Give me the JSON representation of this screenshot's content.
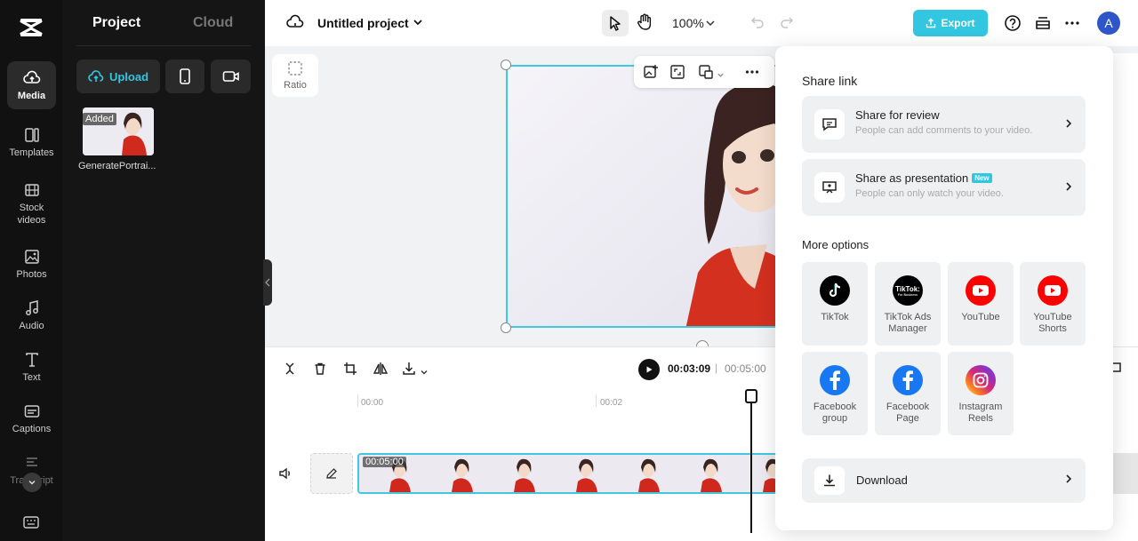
{
  "sidebar": {
    "items": [
      {
        "label": "Media",
        "icon": "cloud-media-icon",
        "active": true
      },
      {
        "label": "Templates",
        "icon": "templates-icon"
      },
      {
        "label": "Stock videos",
        "icon": "film-icon"
      },
      {
        "label": "Photos",
        "icon": "image-icon"
      },
      {
        "label": "Audio",
        "icon": "music-note-icon"
      },
      {
        "label": "Text",
        "icon": "text-icon"
      },
      {
        "label": "Captions",
        "icon": "captions-icon"
      },
      {
        "label": "Transcript",
        "icon": "transcript-icon"
      }
    ]
  },
  "panel": {
    "tabs": [
      "Project",
      "Cloud"
    ],
    "upload_label": "Upload",
    "media_items": [
      {
        "badge": "Added",
        "name": "GeneratePortrai..."
      }
    ]
  },
  "topbar": {
    "project_title": "Untitled project",
    "zoom": "100%",
    "export_label": "Export",
    "avatar_letter": "A"
  },
  "canvas": {
    "ratio_label": "Ratio"
  },
  "timeline": {
    "current_time": "00:03:09",
    "separator": "|",
    "total_time": "00:05:00",
    "ruler": [
      "00:00",
      "00:02"
    ],
    "clip_duration": "00:05:00"
  },
  "share": {
    "title": "Share link",
    "review": {
      "title": "Share for review",
      "subtitle": "People can add comments to your video."
    },
    "presentation": {
      "title": "Share as presentation",
      "badge": "New",
      "subtitle": "People can only watch your video."
    },
    "more_options_title": "More options",
    "options": [
      {
        "label": "TikTok",
        "icon": "tiktok-icon"
      },
      {
        "label": "TikTok Ads Manager",
        "icon": "tiktok-ads-icon"
      },
      {
        "label": "YouTube",
        "icon": "youtube-icon"
      },
      {
        "label": "YouTube Shorts",
        "icon": "youtube-shorts-icon"
      },
      {
        "label": "Facebook group",
        "icon": "facebook-icon"
      },
      {
        "label": "Facebook Page",
        "icon": "facebook-icon"
      },
      {
        "label": "Instagram Reels",
        "icon": "instagram-icon"
      }
    ],
    "download_label": "Download"
  },
  "colors": {
    "accent": "#33c6e0",
    "rail_bg": "#111111",
    "panel_bg": "#151515",
    "youtube": "#ff0000",
    "facebook": "#1877f2"
  }
}
